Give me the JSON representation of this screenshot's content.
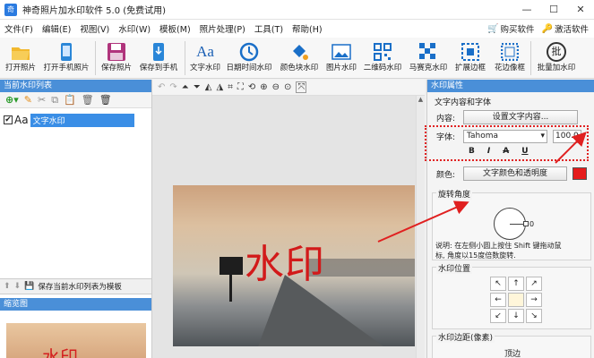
{
  "app": {
    "title": "神奇照片加水印软件 5.0 (免费试用)",
    "icon_label": "奇"
  },
  "window_controls": {
    "minimize": "—",
    "maximize": "☐",
    "close": "✕"
  },
  "menu": {
    "items": [
      "文件(F)",
      "编辑(E)",
      "视图(V)",
      "水印(W)",
      "模板(M)",
      "照片处理(P)",
      "工具(T)",
      "帮助(H)"
    ],
    "buy": "购买软件",
    "activate": "激活软件"
  },
  "toolbar": {
    "items": [
      "打开照片",
      "打开手机照片",
      "保存照片",
      "保存到手机",
      "文字水印",
      "日期时间水印",
      "颜色块水印",
      "图片水印",
      "二维码水印",
      "马赛克水印",
      "扩展边框",
      "花边像框",
      "批量加水印"
    ],
    "text_wm_icon_glyph": "Aa",
    "batch_icon_glyph": "批"
  },
  "left_panel": {
    "title": "当前水印列表",
    "watermark_items": [
      {
        "glyph": "Aa",
        "label": "文字水印",
        "checked": true
      }
    ],
    "save_as_template": "保存当前水印列表为模板",
    "thumb_title": "缩览图",
    "thumb_watermark": "水印"
  },
  "canvas": {
    "watermark_text": "水印"
  },
  "right_panel": {
    "title": "水印属性",
    "text_group": "文字内容和字体",
    "content_label": "内容:",
    "content_button": "设置文字内容...",
    "font_label": "字体:",
    "font_value": "Tahoma",
    "size_value": "100.0",
    "bold": "B",
    "italic": "I",
    "strike": "A",
    "underline": "U",
    "color_label": "颜色:",
    "color_button": "文字颜色和透明度",
    "text_color": "#e51c1c",
    "rotate_group": "旋转角度",
    "rotate_value": "0",
    "rotate_hint_1": "说明: 在左侧小圆上按住 Shift 键拖动鼠",
    "rotate_hint_2": "标, 角度以15度倍数旋转.",
    "position_group": "水印位置",
    "position_arrows": [
      "↖",
      "↑",
      "↗",
      "←",
      "",
      "→",
      "↙",
      "↓",
      "↘"
    ],
    "margin_group": "水印边距(像素)",
    "margin_top": "顶边"
  },
  "colors": {
    "accent": "#4a8fd8",
    "selection": "#3a8ee6",
    "watermark": "#d21a1a",
    "highlight_box": "#e02020"
  }
}
